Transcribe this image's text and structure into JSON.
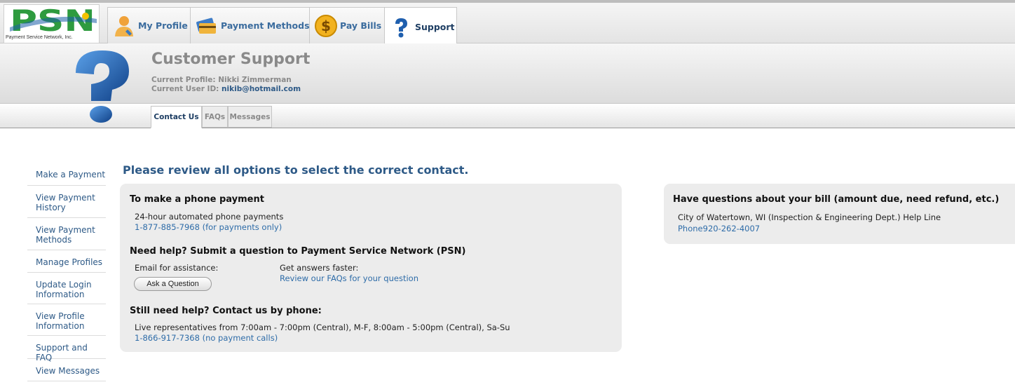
{
  "nav": {
    "logo_text": "PSN",
    "logo_subtitle": "Payment Service Network, Inc.",
    "tabs": [
      {
        "label": "My Profile",
        "icon": "user-icon"
      },
      {
        "label": "Payment Methods",
        "icon": "cards-icon"
      },
      {
        "label": "Pay Bills",
        "icon": "dollar-coin-icon"
      },
      {
        "label": "Support",
        "icon": "question-icon"
      }
    ],
    "active_tab": "Support"
  },
  "header": {
    "title": "Customer Support",
    "profile_label": "Current Profile: Nikki Zimmerman",
    "userid_label": "Current User ID: ",
    "userid_value": "nikib@hotmail.com"
  },
  "subtabs": [
    {
      "label": "Contact Us",
      "active": true
    },
    {
      "label": "FAQs",
      "active": false
    },
    {
      "label": "Messages",
      "active": false
    }
  ],
  "sidebar": {
    "items": [
      {
        "label": "Make a Payment"
      },
      {
        "label": "View Payment History"
      },
      {
        "label": "View Payment Methods"
      },
      {
        "label": "Manage Profiles"
      },
      {
        "label": "Update Login Information"
      },
      {
        "label": "View Profile Information"
      },
      {
        "label": "Support and FAQ"
      },
      {
        "label": "View Messages"
      }
    ]
  },
  "main": {
    "headline": "Please review all options to select the correct contact.",
    "phone_payment": {
      "heading": "To make a phone payment",
      "desc": "24-hour automated phone payments",
      "number": "1-877-885-7968 (for payments only)"
    },
    "help": {
      "heading": "Need help? Submit a question to Payment Service Network (PSN)",
      "email_label": "Email for assistance:",
      "ask_button": "Ask a Question",
      "faster_label": "Get answers faster:",
      "faq_link": "Review our FAQs for your question"
    },
    "phone_help": {
      "heading": "Still need help? Contact us by phone:",
      "hours": "Live representatives from 7:00am - 7:00pm (Central), M-F, 8:00am - 5:00pm (Central), Sa-Su",
      "number": "1-866-917-7368 (no payment calls)"
    }
  },
  "right": {
    "heading": "Have questions about your bill (amount due, need refund, etc.)",
    "line": "City of Watertown, WI (Inspection & Engineering Dept.) Help Line",
    "phone": "Phone920-262-4007"
  },
  "colors": {
    "link": "#2e6ca8",
    "brand_green": "#2e9b3f",
    "brand_blue": "#1b5fa8",
    "heading_gray": "#8a8a8a"
  }
}
